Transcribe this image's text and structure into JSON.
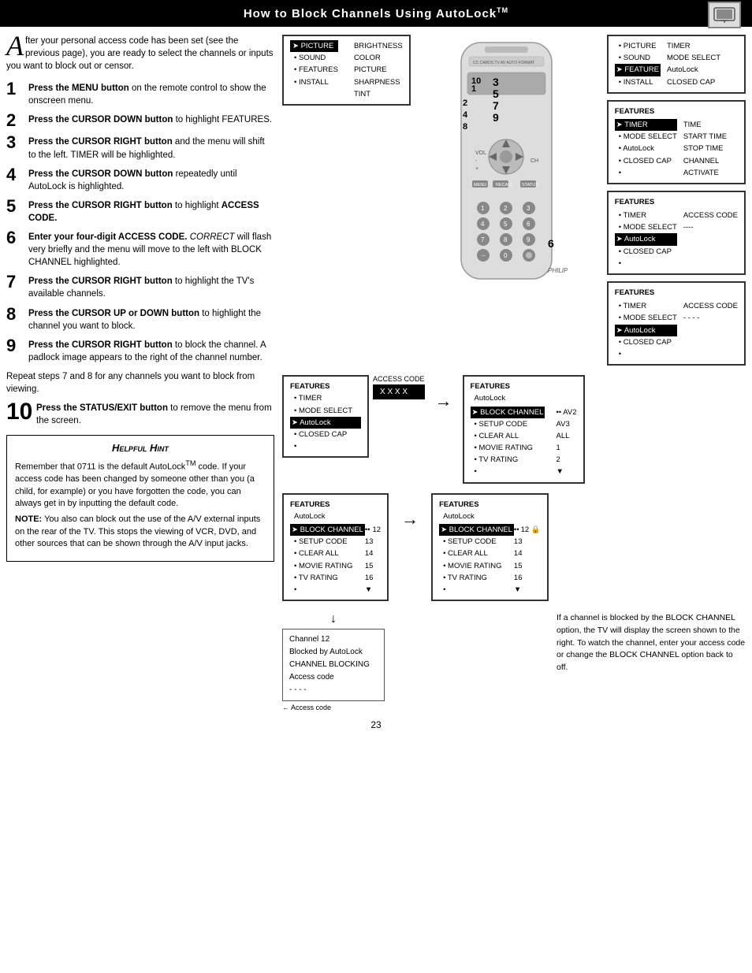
{
  "header": {
    "title": "How to Block Channels Using AutoLock",
    "tm": "TM"
  },
  "intro": {
    "drop_cap": "A",
    "text": "fter your personal access code has been set (see the previous page), you are ready to select the channels or inputs you want to block out or censor."
  },
  "steps": [
    {
      "num": "1",
      "large": false,
      "text": "Press the MENU button on the remote control to show the onscreen menu."
    },
    {
      "num": "2",
      "large": false,
      "text": "Press the CURSOR DOWN button to highlight FEATURES."
    },
    {
      "num": "3",
      "large": false,
      "text": "Press the CURSOR RIGHT button and the menu will shift to the left. TIMER will be highlighted."
    },
    {
      "num": "4",
      "large": false,
      "text": "Press the CURSOR DOWN button repeatedly until AutoLock is highlighted."
    },
    {
      "num": "5",
      "large": false,
      "text": "Press the CURSOR RIGHT button to highlight ACCESS CODE."
    },
    {
      "num": "6",
      "large": false,
      "text": "Enter your four-digit ACCESS CODE. CORRECT will flash very briefly and the menu will move to the left with BLOCK CHANNEL highlighted."
    },
    {
      "num": "7",
      "large": false,
      "text": "Press the CURSOR RIGHT button to highlight the TV's available channels."
    },
    {
      "num": "8",
      "large": false,
      "text": "Press the CURSOR UP or DOWN button to highlight the channel you want to block."
    },
    {
      "num": "9",
      "large": false,
      "text": "Press the CURSOR RIGHT button to block the channel. A padlock image appears to the right of the channel number."
    },
    {
      "num": "10",
      "large": true,
      "text": "Press the STATUS/EXIT button to remove the menu from the screen."
    }
  ],
  "repeat_text": "Repeat steps 7 and 8 for any channels you want to block from viewing.",
  "hint": {
    "title": "Helpful Hint",
    "paragraphs": [
      "Remember that 0711 is the default AutoLock™ code.  If your access code has been changed by someone other than you (a child, for example) or you have forgotten the code, you can always get in by inputting the default code.",
      "NOTE:  You also can block out the use of the A/V external inputs on the rear of the TV.  This stops the viewing of VCR, DVD, and other sources that can be shown through the A/V input jacks."
    ]
  },
  "menus": {
    "menu1": {
      "title": "",
      "items": [
        "PICTURE",
        "• SOUND",
        "• FEATURES",
        "• INSTALL"
      ],
      "right_items": [
        "BRIGHTNESS",
        "COLOR",
        "PICTURE",
        "SHARPNESS",
        "TINT"
      ],
      "highlighted": "PICTURE"
    },
    "menu2": {
      "title": "",
      "items": [
        "• PICTURE",
        "• SOUND",
        "FEATURE",
        "• INSTALL"
      ],
      "right_items": [
        "TIMER",
        "MODE SELECT",
        "AutoLock",
        "CLOSED CAP"
      ],
      "highlighted": "FEATURE"
    },
    "menu3_title": "FEATURES",
    "menu3": {
      "items": [
        "TIMER",
        "• MODE SELECT",
        "• AutoLock",
        "• CLOSED CAP",
        "•"
      ],
      "right_items": [
        "TIME",
        "START TIME",
        "STOP TIME",
        "CHANNEL",
        "ACTIVATE"
      ],
      "highlighted": "TIMER"
    },
    "menu4_title": "FEATURES",
    "menu4": {
      "items": [
        "• TIMER",
        "• MODE SELECT",
        "AutoLock",
        "• CLOSED CAP",
        "•"
      ],
      "right_items": [
        "ACCESS CODE",
        "----"
      ],
      "highlighted": "AutoLock"
    },
    "menu5_title": "FEATURES",
    "menu5": {
      "items": [
        "• TIMER",
        "• MODE SELECT",
        "AutoLock",
        "• CLOSED CAP",
        "•"
      ],
      "right_items": [
        "ACCESS CODE",
        "- - - -"
      ],
      "highlighted": "AutoLock"
    },
    "menu6_title": "FEATURES",
    "menu6_sub": "AutoLock",
    "menu6": {
      "items": [
        "• BLOCK CHANNEL",
        "• SETUP CODE",
        "• CLEAR ALL",
        "• MOVIE RATING",
        "• TV RATING",
        "•"
      ],
      "right_items": [
        "AV2",
        "AV3",
        "ALL",
        "1",
        "2"
      ],
      "highlighted": "BLOCK CHANNEL"
    },
    "menu7_title": "FEATURES",
    "menu7_sub": "AutoLock",
    "menu7_access": "ACCESS CODE",
    "menu7_code": "X X X X",
    "menu7": {
      "items": [
        "• TIMER",
        "• MODE SELECT",
        "AutoLock",
        "• CLOSED CAP",
        "•"
      ]
    },
    "menu8_title": "FEATURES",
    "menu8_sub": "AutoLock",
    "menu8": {
      "items": [
        "• BLOCK CHANNEL",
        "• SETUP CODE",
        "• CLEAR ALL",
        "• MOVIE RATING",
        "• TV RATING",
        "•"
      ],
      "right_items": [
        "12 🔒",
        "13",
        "14",
        "15",
        "16"
      ],
      "highlighted": "BLOCK CHANNEL"
    },
    "menu9_title": "FEATURES",
    "menu9_sub": "AutoLock",
    "menu9": {
      "items": [
        "• BLOCK CHANNEL",
        "• SETUP CODE",
        "• CLEAR ALL",
        "• MOVIE RATING",
        "• TV RATING",
        "•"
      ],
      "right_items": [
        "12",
        "13",
        "14",
        "15",
        "16"
      ],
      "highlighted": "BLOCK CHANNEL"
    }
  },
  "channel_blocked": {
    "line1": "Channel 12",
    "line2": "Blocked by AutoLock",
    "line3": "CHANNEL BLOCKING",
    "line4": "Access code",
    "line5": "- - - -"
  },
  "lower_right_desc": "If a channel is blocked by the BLOCK CHANNEL option, the TV will display the screen shown to the right. To watch the channel, enter your access code or change the BLOCK CHANNEL option back to off.",
  "page_number": "23",
  "remote_numbers": [
    "10",
    "1",
    "2",
    "4",
    "8",
    "3",
    "5",
    "7",
    "9",
    "6"
  ]
}
